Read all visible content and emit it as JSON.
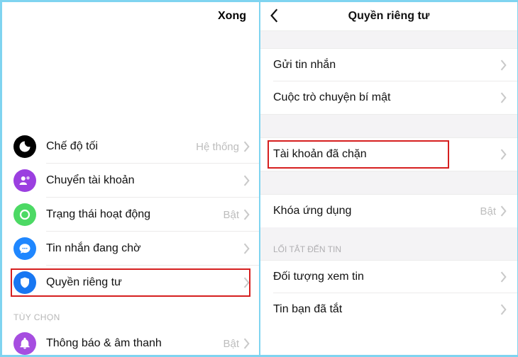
{
  "left": {
    "done": "Xong",
    "rows": [
      {
        "label": "Chế độ tối",
        "value": "Hệ thống"
      },
      {
        "label": "Chuyển tài khoản",
        "value": ""
      },
      {
        "label": "Trạng thái hoạt động",
        "value": "Bật"
      },
      {
        "label": "Tin nhắn đang chờ",
        "value": ""
      },
      {
        "label": "Quyền riêng tư",
        "value": ""
      }
    ],
    "section": "TÙY CHỌN",
    "notif": {
      "label": "Thông báo & âm thanh",
      "value": "Bật"
    }
  },
  "right": {
    "title": "Quyền riêng tư",
    "rows1": [
      {
        "label": "Gửi tin nhắn"
      },
      {
        "label": "Cuộc trò chuyện bí mật"
      }
    ],
    "blocked": {
      "label": "Tài khoản đã chặn"
    },
    "applock": {
      "label": "Khóa ứng dụng",
      "value": "Bật"
    },
    "section": "LỐI TẮT ĐẾN TIN",
    "rows2": [
      {
        "label": "Đối tượng xem tin"
      },
      {
        "label": "Tin bạn đã tắt"
      }
    ]
  }
}
